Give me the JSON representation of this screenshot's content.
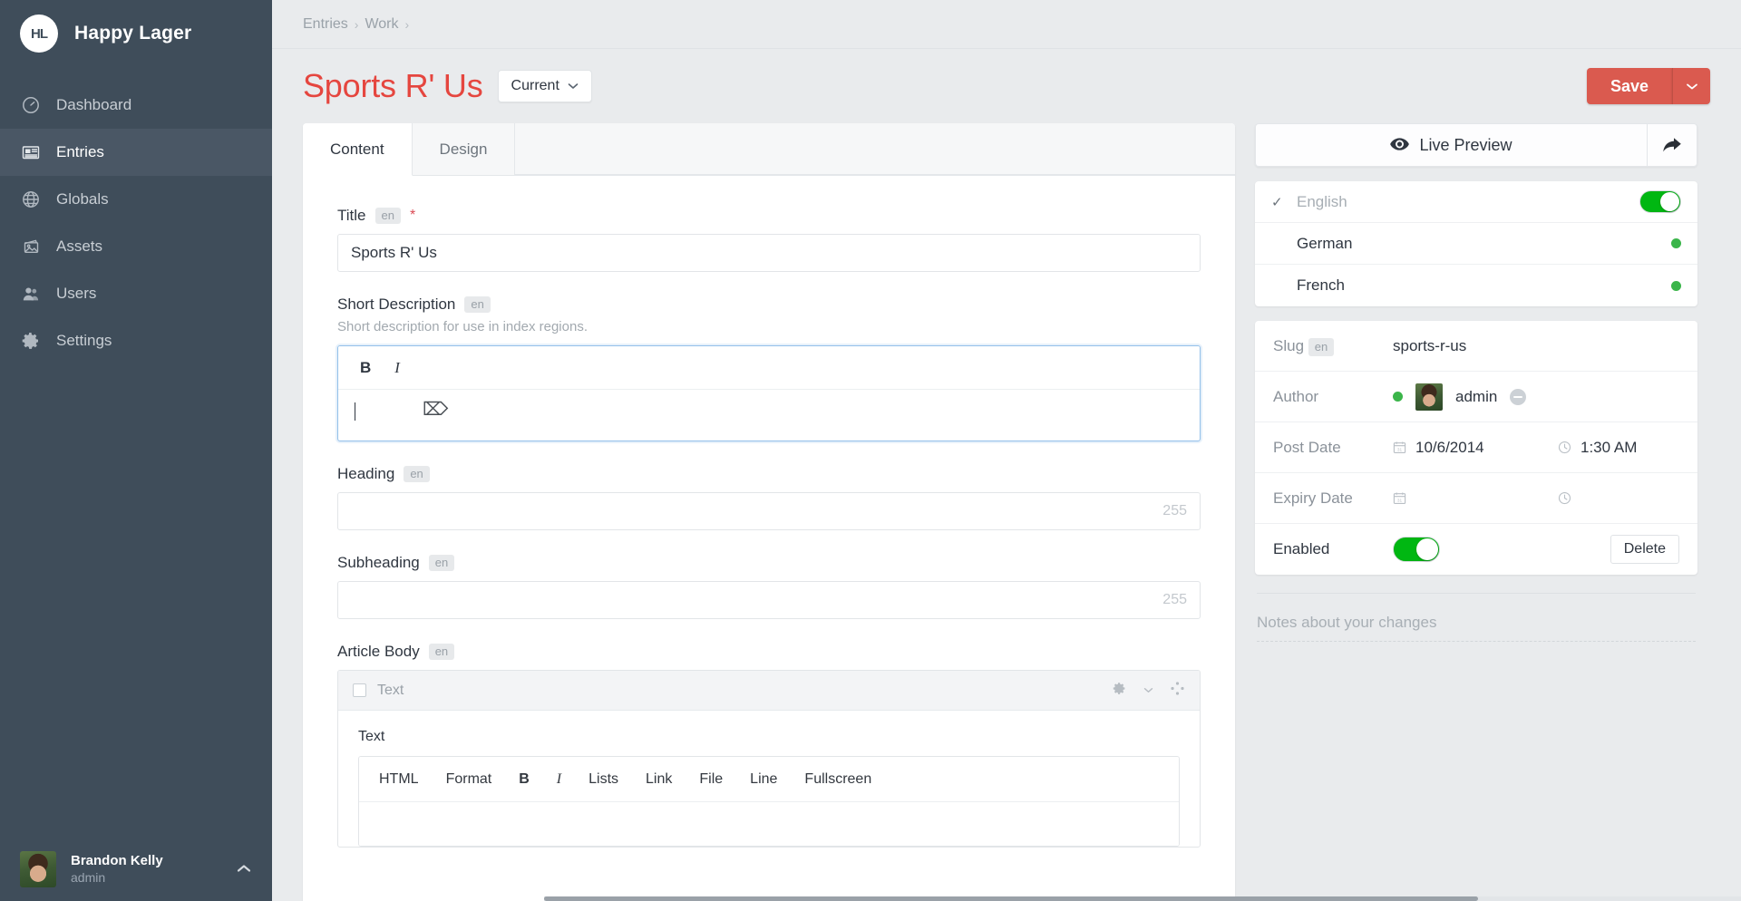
{
  "sidebar": {
    "brand": {
      "initials": "HL",
      "name": "Happy Lager"
    },
    "items": [
      {
        "label": "Dashboard",
        "icon": "gauge-icon",
        "active": false
      },
      {
        "label": "Entries",
        "icon": "newspaper-icon",
        "active": true
      },
      {
        "label": "Globals",
        "icon": "globe-icon",
        "active": false
      },
      {
        "label": "Assets",
        "icon": "photos-icon",
        "active": false
      },
      {
        "label": "Users",
        "icon": "users-icon",
        "active": false
      },
      {
        "label": "Settings",
        "icon": "gear-icon",
        "active": false
      }
    ],
    "user": {
      "name": "Brandon Kelly",
      "role": "admin",
      "caret": "chevron-up-icon"
    }
  },
  "breadcrumb": {
    "items": [
      "Entries",
      "Work"
    ],
    "separator": "›"
  },
  "header": {
    "title": "Sports R' Us",
    "title_color": "#e5463f",
    "revision_label": "Current",
    "save_label": "Save",
    "save_color": "#da5a4f"
  },
  "tabs": [
    {
      "label": "Content",
      "active": true
    },
    {
      "label": "Design",
      "active": false
    }
  ],
  "fields": {
    "title": {
      "label": "Title",
      "lang": "en",
      "required_marker": "*",
      "value": "Sports R' Us",
      "placeholder": ""
    },
    "short_description": {
      "label": "Short Description",
      "lang": "en",
      "instructions": "Short description for use in index regions.",
      "toolbar": [
        "B",
        "I"
      ],
      "value": "",
      "focused": true
    },
    "heading": {
      "label": "Heading",
      "lang": "en",
      "value": "",
      "counter": "255"
    },
    "subheading": {
      "label": "Subheading",
      "lang": "en",
      "value": "",
      "counter": "255"
    },
    "article_body": {
      "label": "Article Body",
      "lang": "en",
      "block": {
        "type_label": "Text",
        "sub_label": "Text",
        "settings_icon": "gear-icon",
        "move_icon": "move-handle-icon",
        "toolbar": [
          "HTML",
          "Format",
          "B",
          "I",
          "Lists",
          "Link",
          "File",
          "Line",
          "Fullscreen"
        ],
        "value": ""
      }
    }
  },
  "side": {
    "live_preview_label": "Live Preview",
    "live_preview_icon": "eye-icon",
    "share_icon": "share-arrow-icon",
    "languages": [
      {
        "label": "English",
        "current": true,
        "check": "✓",
        "control": "toggle",
        "enabled": true
      },
      {
        "label": "German",
        "current": false,
        "check": "",
        "control": "dot",
        "enabled": true
      },
      {
        "label": "French",
        "current": false,
        "check": "",
        "control": "dot",
        "enabled": true
      }
    ],
    "meta": {
      "slug": {
        "label": "Slug",
        "lang": "en",
        "value": "sports-r-us"
      },
      "author": {
        "label": "Author",
        "value": "admin",
        "status_dot": "#3bb54a",
        "avatar": "avatar",
        "remove_icon": "remove-icon"
      },
      "post_date": {
        "label": "Post Date",
        "date": "10/6/2014",
        "time": "1:30 AM",
        "date_icon": "calendar-icon",
        "time_icon": "clock-icon"
      },
      "expiry_date": {
        "label": "Expiry Date",
        "date": "",
        "time": "",
        "date_icon": "calendar-icon",
        "time_icon": "clock-icon"
      },
      "enabled": {
        "label": "Enabled",
        "value": true,
        "delete_label": "Delete"
      }
    },
    "notes_placeholder": "Notes about your changes"
  }
}
